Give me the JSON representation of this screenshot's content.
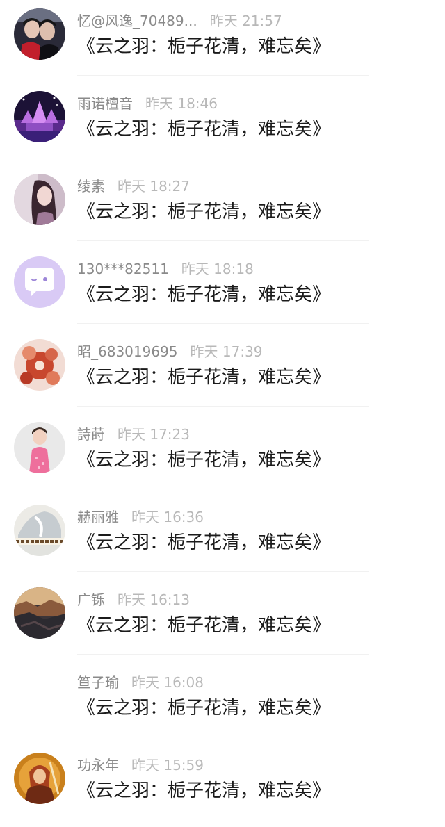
{
  "comments": [
    {
      "username": "忆@风逸_70489...",
      "time": "昨天 21:57",
      "message": "《云之羽：栀子花清，难忘矣》",
      "avatar": "couple-avatar"
    },
    {
      "username": "雨诺檀音",
      "time": "昨天 18:46",
      "message": "《云之羽：栀子花清，难忘矣》",
      "avatar": "purple-castle-avatar"
    },
    {
      "username": "绫素",
      "time": "昨天 18:27",
      "message": "《云之羽：栀子花清，难忘矣》",
      "avatar": "woman-portrait-avatar"
    },
    {
      "username": "130***82511",
      "time": "昨天 18:18",
      "message": "《云之羽：栀子花清，难忘矣》",
      "avatar": "default-chat-avatar"
    },
    {
      "username": "昭_683019695",
      "time": "昨天 17:39",
      "message": "《云之羽：栀子花清，难忘矣》",
      "avatar": "red-flower-avatar"
    },
    {
      "username": "詩莳",
      "time": "昨天 17:23",
      "message": "《云之羽：栀子花清，难忘矣》",
      "avatar": "girl-pink-dress-avatar"
    },
    {
      "username": "赫丽雅",
      "time": "昨天 16:36",
      "message": "《云之羽：栀子花清，难忘矣》",
      "avatar": "calligraphy-avatar"
    },
    {
      "username": "广铄",
      "time": "昨天 16:13",
      "message": "《云之羽：栀子花清，难忘矣》",
      "avatar": "canyon-avatar"
    },
    {
      "username": "笪子瑜",
      "time": "昨天 16:08",
      "message": "《云之羽：栀子花清，难忘矣》",
      "avatar": "none"
    },
    {
      "username": "功永年",
      "time": "昨天 15:59",
      "message": "《云之羽：栀子花清，难忘矣》",
      "avatar": "warrior-avatar"
    }
  ]
}
